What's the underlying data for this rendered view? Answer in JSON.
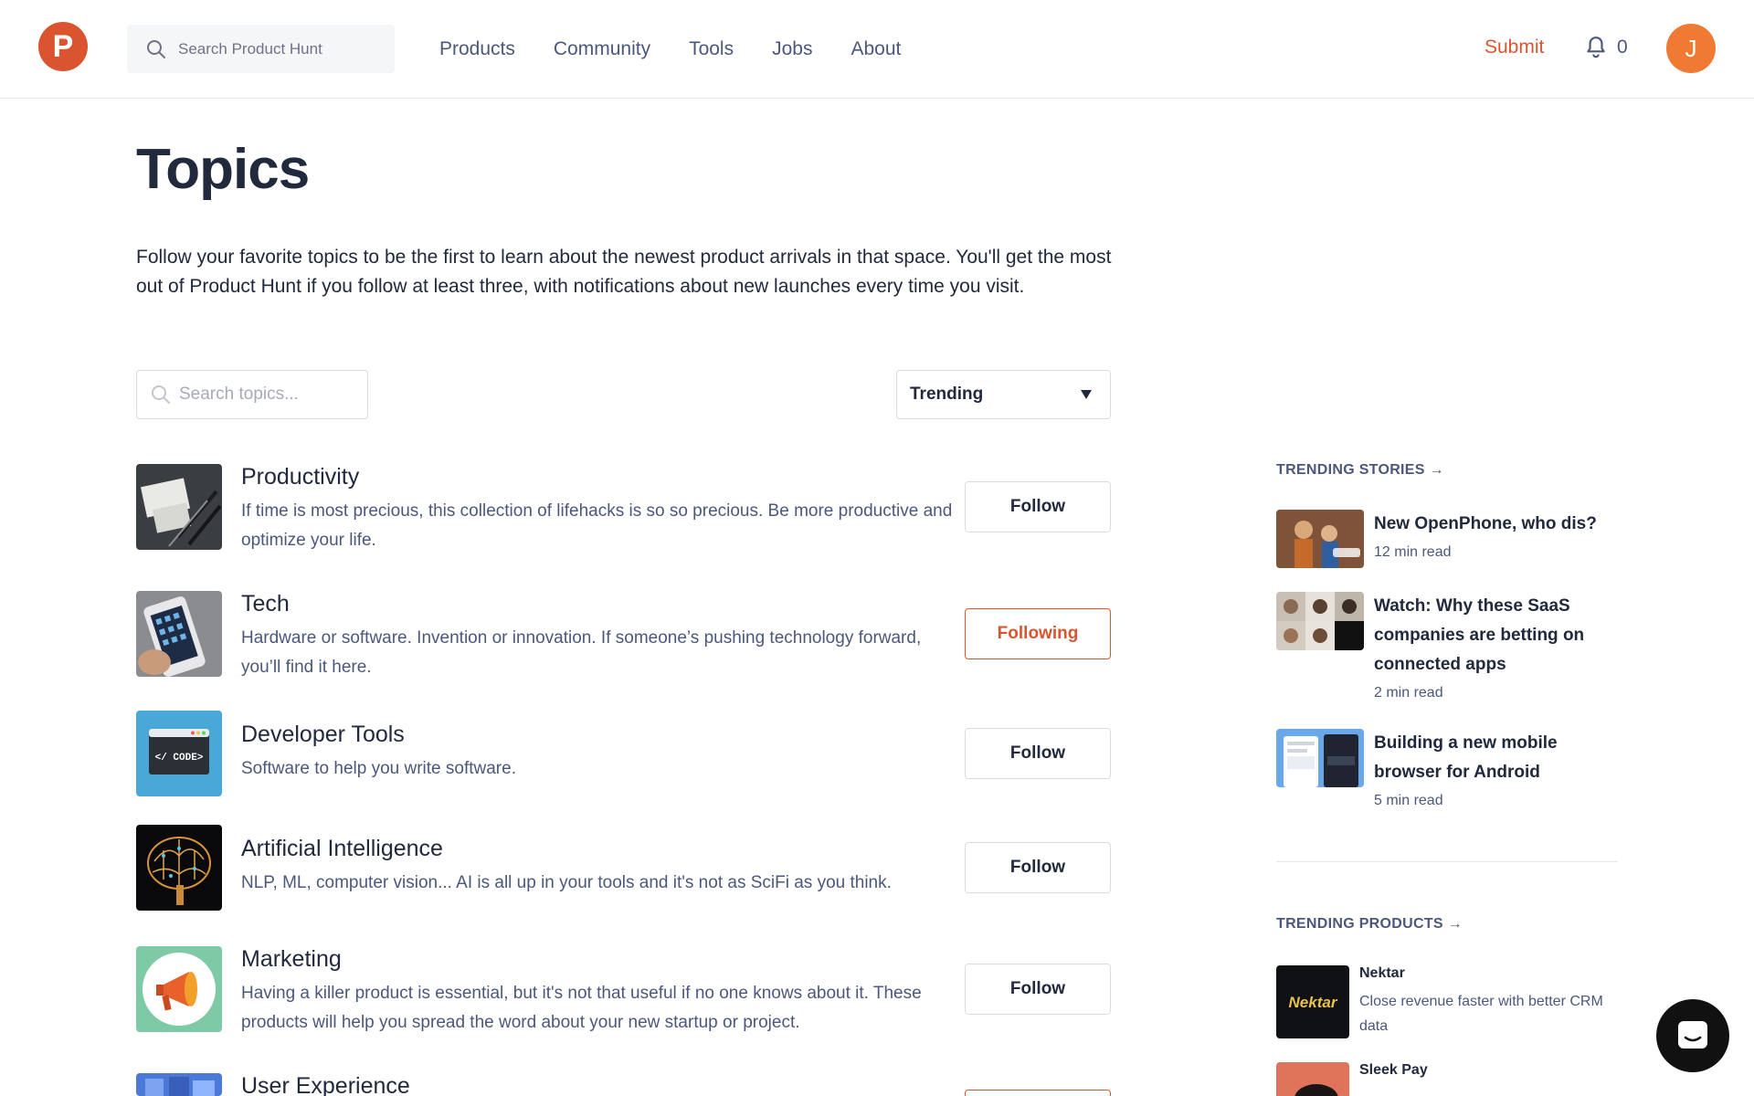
{
  "header": {
    "logo_letter": "P",
    "search_placeholder": "Search Product Hunt",
    "nav": [
      "Products",
      "Community",
      "Tools",
      "Jobs",
      "About"
    ],
    "submit_label": "Submit",
    "notification_count": "0",
    "avatar_letter": "J"
  },
  "main": {
    "title": "Topics",
    "intro": "Follow your favorite topics to be the first to learn about the newest product arrivals in that space. You'll get the most out of Product Hunt if you follow at least three, with notifications about new launches every time you visit.",
    "topic_search_placeholder": "Search topics...",
    "sort_selected": "Trending",
    "topics": [
      {
        "name": "Productivity",
        "description": "If time is most precious, this collection of lifehacks is so so precious. Be more productive and optimize your life.",
        "button": "Follow"
      },
      {
        "name": "Tech",
        "description": "Hardware or software. Invention or innovation. If someone’s pushing technology forward, you’ll find it here.",
        "button": "Following"
      },
      {
        "name": "Developer Tools",
        "description": "Software to help you write software.",
        "button": "Follow",
        "thumb_text": "</ CODE>"
      },
      {
        "name": "Artificial Intelligence",
        "description": "NLP, ML, computer vision... AI is all up in your tools and it's not as SciFi as you think.",
        "button": "Follow"
      },
      {
        "name": "Marketing",
        "description": "Having a killer product is essential, but it's not that useful if no one knows about it. These products will help you spread the word about your new startup or project.",
        "button": "Follow"
      },
      {
        "name": "User Experience",
        "description": "",
        "button": ""
      }
    ]
  },
  "sidebar": {
    "trending_stories_heading": "TRENDING STORIES →",
    "stories": [
      {
        "title": "New OpenPhone, who dis?",
        "read": "12 min read"
      },
      {
        "title": "Watch: Why these SaaS companies are betting on connected apps",
        "read": "2 min read"
      },
      {
        "title": "Building a new mobile browser for Android",
        "read": "5 min read"
      }
    ],
    "trending_products_heading": "TRENDING PRODUCTS →",
    "products": [
      {
        "name": "Nektar",
        "tagline": "Close revenue faster with better CRM data",
        "logo_text": "Nektar"
      },
      {
        "name": "Sleek Pay",
        "tagline": ""
      }
    ]
  },
  "colors": {
    "brand": "#da552f",
    "text": "#21293c",
    "muted": "#4b587c"
  }
}
